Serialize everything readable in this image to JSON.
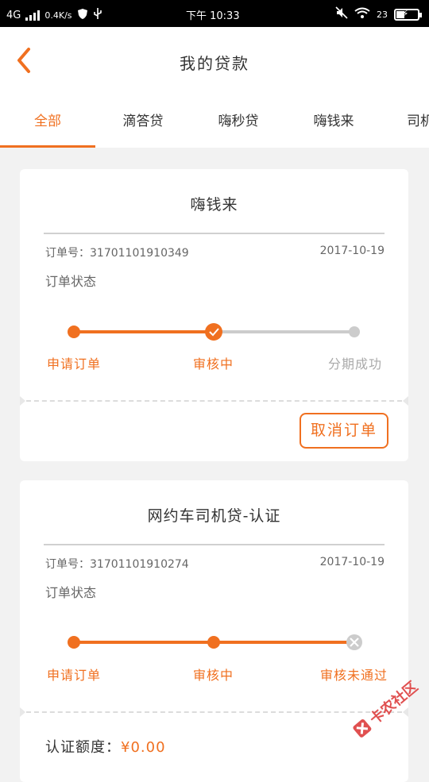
{
  "status_bar": {
    "network": "4G",
    "speed": "0.4K/s",
    "time": "下午 10:33",
    "battery": "23"
  },
  "header": {
    "title": "我的贷款"
  },
  "tabs": [
    "全部",
    "滴答贷",
    "嗨秒贷",
    "嗨钱来",
    "司机"
  ],
  "orders": [
    {
      "title": "嗨钱来",
      "order_no": "订单号：31701101910349",
      "date": "2017-10-19",
      "status_label": "订单状态",
      "steps": [
        "申请订单",
        "审核中",
        "分期成功"
      ],
      "progress": 0.5,
      "action": "取消订单"
    },
    {
      "title": "网约车司机贷-认证",
      "order_no": "订单号：31701101910274",
      "date": "2017-10-19",
      "status_label": "订单状态",
      "steps": [
        "申请订单",
        "审核中",
        "审核未通过"
      ],
      "progress": 1.0,
      "amount_label": "认证额度：",
      "amount_value": "¥0.00"
    }
  ],
  "watermark": "卡农社区",
  "colors": {
    "accent": "#f07020",
    "inactive": "#cccccc"
  }
}
